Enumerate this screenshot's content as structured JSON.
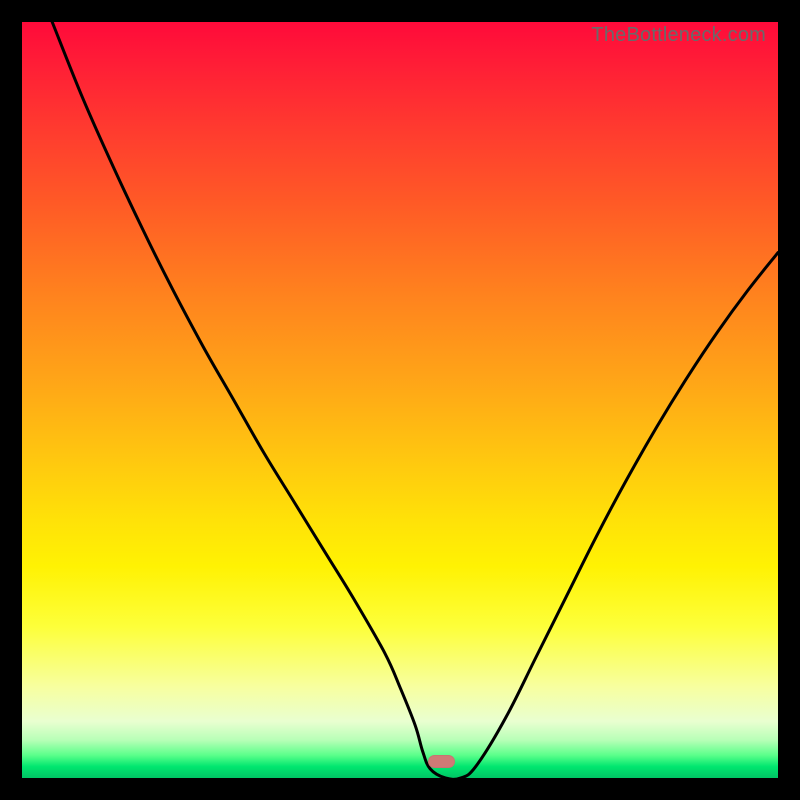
{
  "watermark": "TheBottleneck.com",
  "colors": {
    "frame": "#000000",
    "gradient_top": "#ff0a3a",
    "gradient_bottom": "#00c565",
    "curve": "#000000",
    "marker": "#cf7a76"
  },
  "chart_data": {
    "type": "line",
    "title": "",
    "xlabel": "",
    "ylabel": "",
    "xlim": [
      0,
      100
    ],
    "ylim": [
      0,
      100
    ],
    "annotations": [
      "TheBottleneck.com"
    ],
    "legend": false,
    "grid": false,
    "series": [
      {
        "name": "bottleneck-curve",
        "x": [
          4,
          8,
          12,
          16,
          20,
          24,
          28,
          32,
          36,
          40,
          44,
          48,
          50,
          52,
          53,
          54,
          56,
          58,
          60,
          64,
          68,
          72,
          76,
          80,
          84,
          88,
          92,
          96,
          100
        ],
        "y": [
          100,
          90,
          81,
          72.5,
          64.5,
          57,
          50,
          43,
          36.5,
          30,
          23.5,
          16.5,
          12,
          7,
          3.5,
          1.2,
          0,
          0,
          1.5,
          8,
          16,
          24,
          32,
          39.5,
          46.5,
          53,
          59,
          64.5,
          69.5
        ]
      }
    ],
    "marker": {
      "x_center": 55.5,
      "width_pct": 3.5
    }
  }
}
